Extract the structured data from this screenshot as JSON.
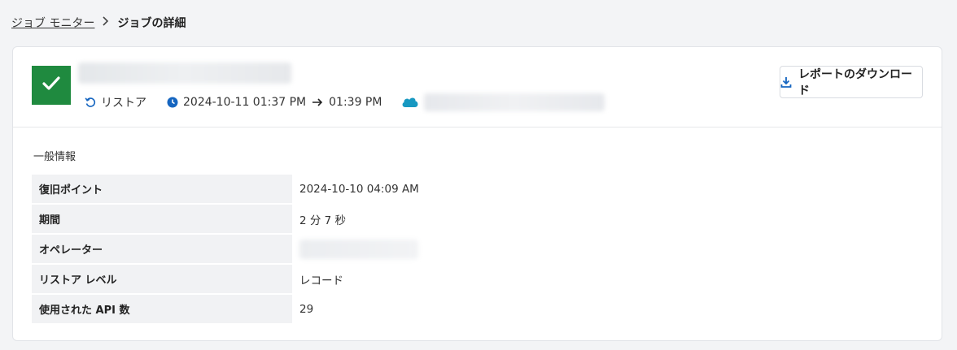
{
  "breadcrumb": {
    "parent": "ジョブ モニター",
    "separator": ">",
    "current": "ジョブの詳細"
  },
  "job": {
    "status_icon": "check-icon",
    "status_color": "#1f8a3f",
    "type_label": "リストア",
    "start_time": "2024-10-11 01:37 PM",
    "end_time": "01:39 PM"
  },
  "download_button": {
    "label": "レポートのダウンロード",
    "icon": "download-icon",
    "icon_color": "#1565c0"
  },
  "general_info": {
    "title": "一般情報",
    "rows": [
      {
        "key": "復旧ポイント",
        "value": "2024-10-10 04:09 AM"
      },
      {
        "key": "期間",
        "value": "2 分 7 秒"
      },
      {
        "key": "オペレーター",
        "value": ""
      },
      {
        "key": "リストア レベル",
        "value": "レコード"
      },
      {
        "key": "使用された API 数",
        "value": "29"
      }
    ]
  },
  "colors": {
    "accent": "#1565c0",
    "salesforce": "#1798c1",
    "success": "#1f8a3f"
  }
}
